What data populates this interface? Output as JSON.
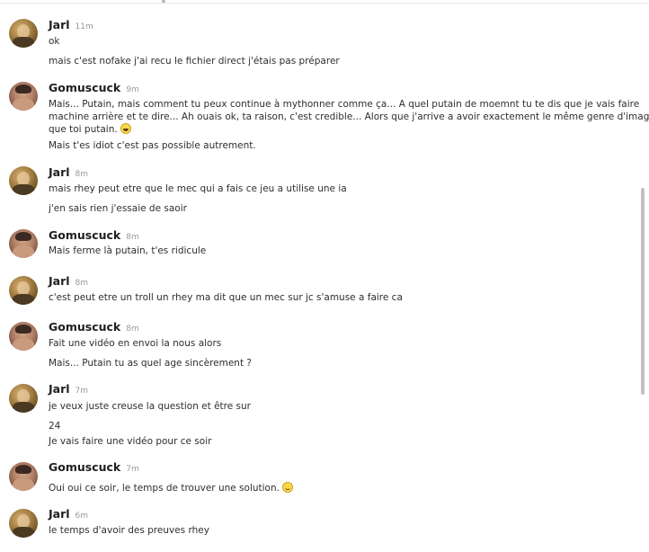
{
  "messages": [
    {
      "user": "Jarl",
      "time": "11m",
      "avatar": "jarl-avatar",
      "lines": [
        "ok",
        "mais c'est nofake j'ai recu le fichier direct j'étais pas préparer"
      ]
    },
    {
      "user": "Gomuscuck",
      "time": "9m",
      "avatar": "gomuscuck-avatar",
      "lines": [
        "Mais... Putain, mais comment tu peux continue à mythonner comme ça... A quel putain de moemnt tu te dis que je vais faire",
        "machine arrière et te dire... Ah ouais ok, ta raison, c'est credible... Alors que j'arrive a avoir exactement le même genre d'image",
        "que toi putain.",
        "Mais t'es idiot c'est pas possible autrement."
      ]
    },
    {
      "user": "Jarl",
      "time": "8m",
      "avatar": "jarl-avatar",
      "lines": [
        "mais rhey peut etre que le mec qui a fais ce jeu a utilise une ia",
        "j'en sais rien j'essaie de saoir"
      ]
    },
    {
      "user": "Gomuscuck",
      "time": "8m",
      "avatar": "gomuscuck-avatar",
      "lines": [
        "Mais ferme là putain, t'es ridicule"
      ]
    },
    {
      "user": "Jarl",
      "time": "8m",
      "avatar": "jarl-avatar",
      "lines": [
        "c'est peut etre un troll un rhey ma dit que un mec sur jc s'amuse a faire ca"
      ]
    },
    {
      "user": "Gomuscuck",
      "time": "8m",
      "avatar": "gomuscuck-avatar",
      "lines": [
        "Fait une vidéo en envoi la nous alors",
        "Mais... Putain tu as quel age sincèrement ?"
      ]
    },
    {
      "user": "Jarl",
      "time": "7m",
      "avatar": "jarl-avatar",
      "lines": [
        "je veux juste creuse la question et être sur",
        "24",
        "Je vais faire une vidéo pour ce soir"
      ]
    },
    {
      "user": "Gomuscuck",
      "time": "7m",
      "avatar": "gomuscuck-avatar",
      "lines": [
        "Oui oui ce soir, le temps de trouver une solution."
      ]
    },
    {
      "user": "Jarl",
      "time": "6m",
      "avatar": "jarl-avatar",
      "lines": [
        "le temps d'avoir des preuves rhey"
      ]
    }
  ],
  "emojis": {
    "laughing": "grinning-squinting-face-icon",
    "smiling": "slightly-smiling-face-icon"
  }
}
